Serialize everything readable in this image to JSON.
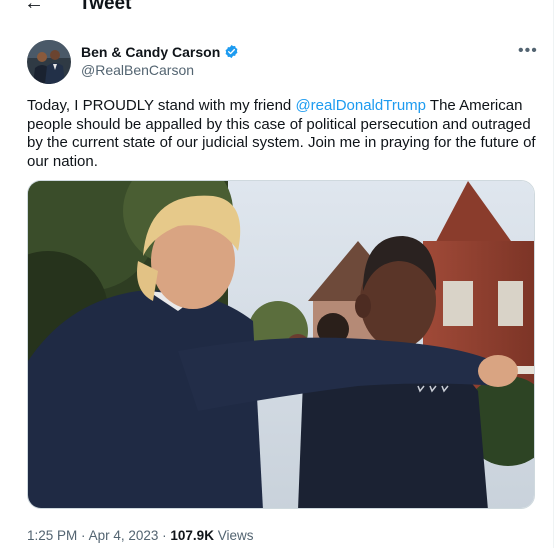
{
  "header": {
    "back_icon": "←",
    "title": "Tweet"
  },
  "tweet": {
    "author_name": "Ben & Candy Carson",
    "handle": "@RealBenCarson",
    "more_icon": "•••",
    "text_before": "Today, I PROUDLY stand with my friend ",
    "mention": "@realDonaldTrump",
    "text_after": " The American people should be appalled by this case of political persecution and outraged by the current state of our judicial system. Join me in praying for the future of our nation.",
    "time": "1:25 PM",
    "separator": "·",
    "date": "Apr 4, 2023",
    "views_count": "107.9K",
    "views_label": "Views"
  },
  "colors": {
    "accent": "#1d9bf0",
    "secondary_text": "#536471"
  }
}
